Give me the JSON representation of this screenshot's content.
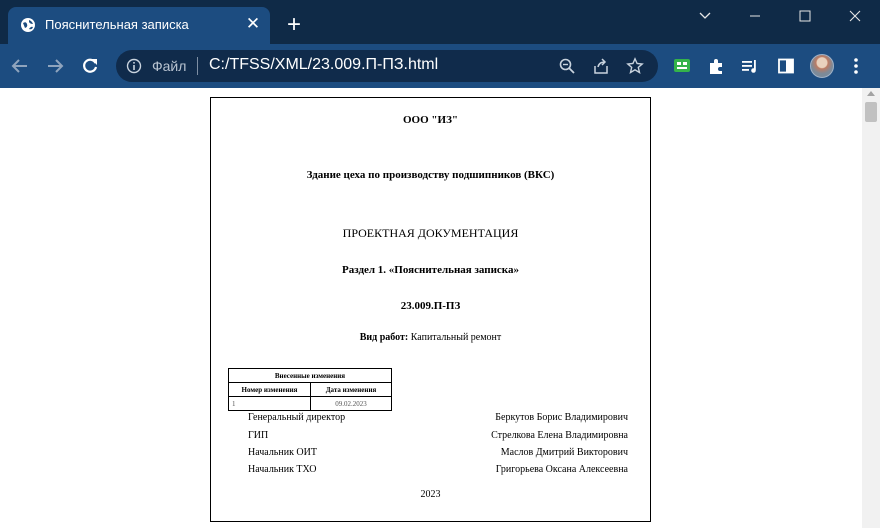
{
  "browser": {
    "tab_title": "Пояснительная записка",
    "new_tab_symbol": "+",
    "omnibox_file_label": "Файл",
    "url": "C:/TFSS/XML/23.009.П-ПЗ.html",
    "colors": {
      "tab_strip": "#0f2a47",
      "toolbar": "#1c4c80",
      "omnibox": "#102b4b"
    },
    "icons": [
      "globe-icon",
      "close-icon",
      "back-icon",
      "forward-icon",
      "reload-icon",
      "info-icon",
      "zoom-icon",
      "share-icon",
      "star-icon",
      "extension-icon",
      "puzzle-icon",
      "media-icon",
      "side-panel-icon",
      "menu-icon",
      "minimize-icon",
      "maximize-icon",
      "window-close-icon",
      "chevron-down-icon"
    ]
  },
  "document": {
    "org": "ООО \"ИЗ\"",
    "object": "Здание цеха по производству подшипников (ВКС)",
    "doc_type": "ПРОЕКТНАЯ ДОКУМЕНТАЦИЯ",
    "section": "Раздел 1. «Пояснительная записка»",
    "code": "23.009.П-ПЗ",
    "work_type_label": "Вид работ:",
    "work_type_value": "Капитальный ремонт",
    "changes_table": {
      "title": "Внесенные изменения",
      "headers": [
        "Номер изменения",
        "Дата изменения"
      ],
      "rows": [
        [
          "1",
          "09.02.2023"
        ]
      ]
    },
    "signatures": [
      {
        "role": "Генеральный директор",
        "name": "Беркутов Борис Владимирович"
      },
      {
        "role": "ГИП",
        "name": "Стрелкова Елена Владимировна"
      },
      {
        "role": "Начальник ОИТ",
        "name": "Маслов Дмитрий Викторович"
      },
      {
        "role": "Начальник ТХО",
        "name": "Григорьева Оксана Алексеевна"
      }
    ],
    "year": "2023"
  }
}
